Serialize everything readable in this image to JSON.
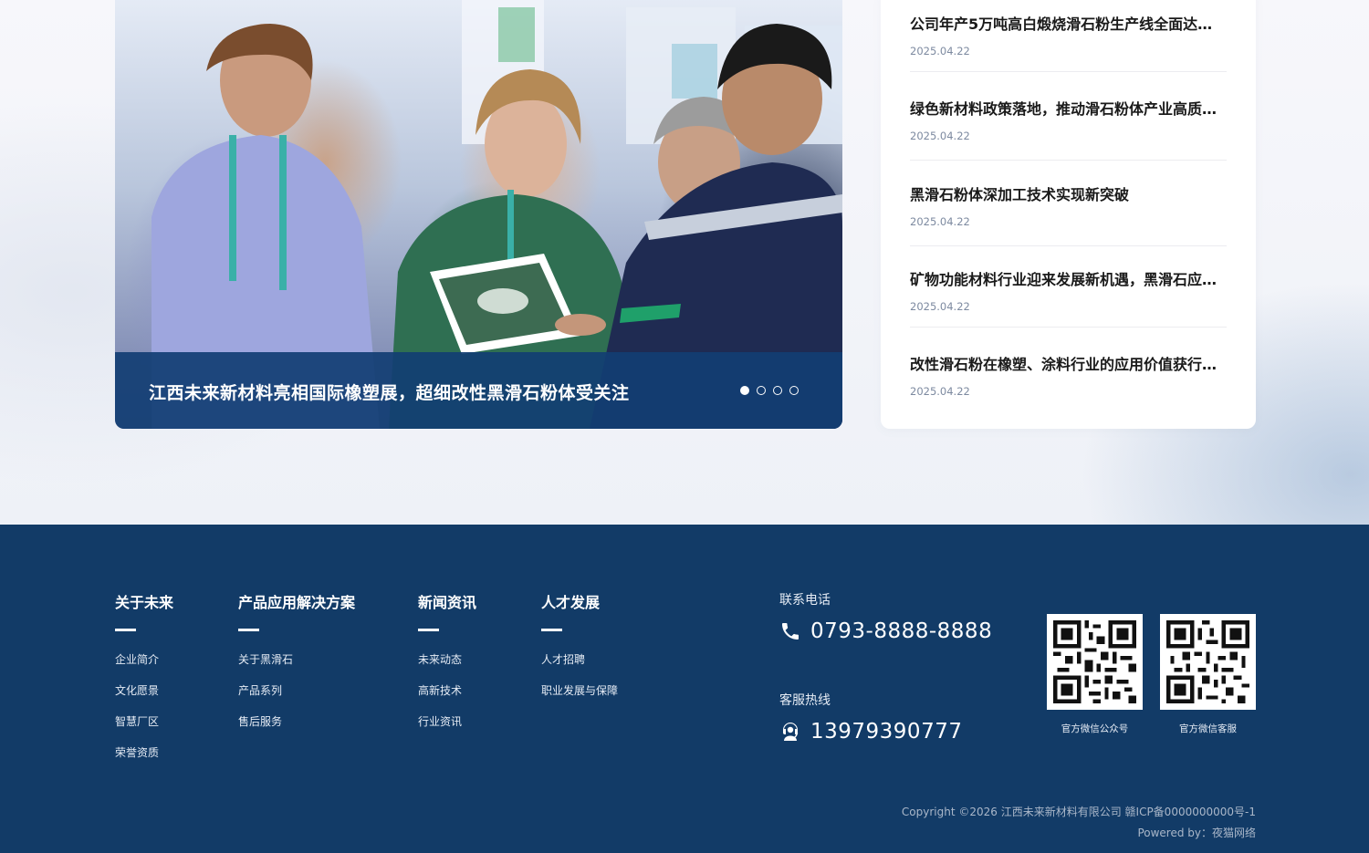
{
  "banner": {
    "caption": "江西未来新材料亮相国际橡塑展，超细改性黑滑石粉体受关注",
    "dots_total": 4,
    "dots_active": 1
  },
  "news": [
    {
      "title": "公司年产5万吨高白煅烧滑石粉生产线全面达产...",
      "date": "2025.04.22"
    },
    {
      "title": "绿色新材料政策落地，推动滑石粉体产业高质量...",
      "date": "2025.04.22"
    },
    {
      "title": "黑滑石粉体深加工技术实现新突破",
      "date": "2025.04.22"
    },
    {
      "title": "矿物功能材料行业迎来发展新机遇，黑滑石应用...",
      "date": "2025.04.22"
    },
    {
      "title": "改性滑石粉在橡塑、涂料行业的应用价值获行业...",
      "date": "2025.04.22"
    }
  ],
  "footer": {
    "nav": [
      {
        "heading": "关于未来",
        "links": [
          "企业简介",
          "文化愿景",
          "智慧厂区",
          "荣誉资质"
        ]
      },
      {
        "heading": "产品应用解决方案",
        "links": [
          "关于黑滑石",
          "产品系列",
          "售后服务"
        ]
      },
      {
        "heading": "新闻资讯",
        "links": [
          "未来动态",
          "高新技术",
          "行业资讯"
        ]
      },
      {
        "heading": "人才发展",
        "links": [
          "人才招聘",
          "职业发展与保障"
        ]
      }
    ],
    "contact": {
      "phone_label": "联系电话",
      "phone_value": "0793-8888-8888",
      "hotline_label": "客服热线",
      "hotline_value": "13979390777",
      "phone_icon": "phone-icon",
      "hotline_icon": "headset-icon"
    },
    "qr": [
      {
        "caption": "官方微信公众号"
      },
      {
        "caption": "官方微信客服"
      }
    ],
    "copyright": "Copyright ©2026 江西未来新材料有限公司  赣ICP备0000000000号-1",
    "powered_by": "Powered by：夜猫网络"
  },
  "colors": {
    "footer_bg": "#123b67",
    "caption_bar": "#123e73",
    "news_title": "#1a1a1a",
    "news_date": "#7d8aa0"
  }
}
